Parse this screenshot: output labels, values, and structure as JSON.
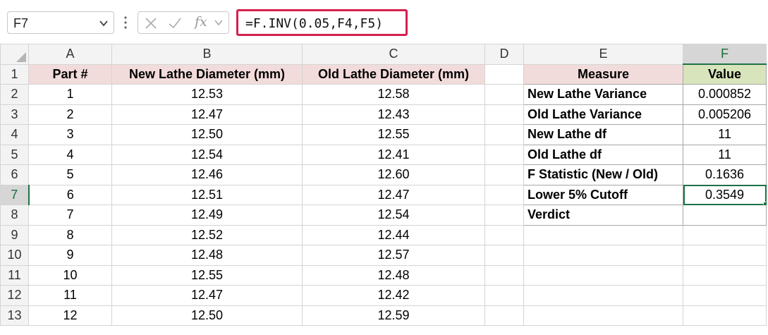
{
  "formula_bar": {
    "name_box": "F7",
    "fx_label": "fx",
    "formula": "=F.INV(0.05,F4,F5)"
  },
  "columns": [
    "A",
    "B",
    "C",
    "D",
    "E",
    "F"
  ],
  "rows": [
    "1",
    "2",
    "3",
    "4",
    "5",
    "6",
    "7",
    "8",
    "9",
    "10",
    "11",
    "12",
    "13"
  ],
  "left_table": {
    "headers": [
      "Part #",
      "New Lathe Diameter (mm)",
      "Old Lathe Diameter (mm)"
    ],
    "rows": [
      [
        "1",
        "12.53",
        "12.58"
      ],
      [
        "2",
        "12.47",
        "12.43"
      ],
      [
        "3",
        "12.50",
        "12.55"
      ],
      [
        "4",
        "12.54",
        "12.41"
      ],
      [
        "5",
        "12.46",
        "12.60"
      ],
      [
        "6",
        "12.51",
        "12.47"
      ],
      [
        "7",
        "12.49",
        "12.54"
      ],
      [
        "8",
        "12.52",
        "12.44"
      ],
      [
        "9",
        "12.48",
        "12.57"
      ],
      [
        "10",
        "12.55",
        "12.48"
      ],
      [
        "11",
        "12.47",
        "12.42"
      ],
      [
        "12",
        "12.50",
        "12.59"
      ]
    ]
  },
  "right_table": {
    "headers": [
      "Measure",
      "Value"
    ],
    "rows": [
      [
        "New Lathe Variance",
        "0.000852"
      ],
      [
        "Old Lathe Variance",
        "0.005206"
      ],
      [
        "New Lathe df",
        "11"
      ],
      [
        "Old Lathe df",
        "11"
      ],
      [
        "F Statistic (New / Old)",
        "0.1636"
      ],
      [
        "Lower 5% Cutoff",
        "0.3549"
      ],
      [
        "Verdict",
        ""
      ]
    ]
  },
  "selection": {
    "active_cell": "F7",
    "active_column": "F",
    "active_row": "7"
  },
  "colors": {
    "header_pink": "#f2dcdb",
    "header_green": "#d8e4bc",
    "formula_highlight": "#d6204f",
    "selection_green": "#1e7145"
  }
}
